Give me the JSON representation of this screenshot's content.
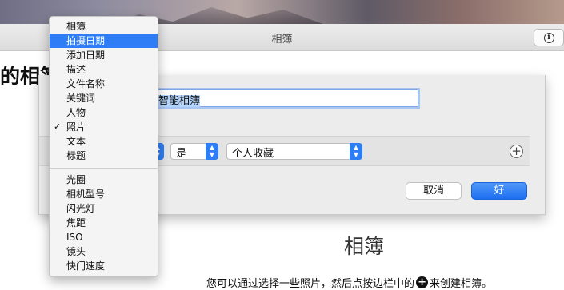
{
  "window": {
    "title": "相簿",
    "heading": "的相簿"
  },
  "empty_state": {
    "title": "相簿",
    "hint_before": "您可以通过选择一些照片，然后点按边栏中的",
    "hint_after": "来创建相簿。",
    "plus_glyph": "+"
  },
  "sheet": {
    "name_field_value": "命名智能相簿",
    "rule": {
      "operator": "是",
      "value": "个人收藏"
    },
    "add_rule_glyph": "+",
    "cancel_label": "取消",
    "ok_label": "好"
  },
  "menu": {
    "group1": [
      {
        "label": "相簿",
        "highlighted": false,
        "checked": false
      },
      {
        "label": "拍摄日期",
        "highlighted": true,
        "checked": false
      },
      {
        "label": "添加日期",
        "highlighted": false,
        "checked": false
      },
      {
        "label": "描述",
        "highlighted": false,
        "checked": false
      },
      {
        "label": "文件名称",
        "highlighted": false,
        "checked": false
      },
      {
        "label": "关键词",
        "highlighted": false,
        "checked": false
      },
      {
        "label": "人物",
        "highlighted": false,
        "checked": false
      },
      {
        "label": "照片",
        "highlighted": false,
        "checked": true
      },
      {
        "label": "文本",
        "highlighted": false,
        "checked": false
      },
      {
        "label": "标题",
        "highlighted": false,
        "checked": false
      }
    ],
    "group2": [
      {
        "label": "光圈"
      },
      {
        "label": "相机型号"
      },
      {
        "label": "闪光灯"
      },
      {
        "label": "焦距"
      },
      {
        "label": "ISO"
      },
      {
        "label": "镜头"
      },
      {
        "label": "快门速度"
      }
    ],
    "check_glyph": "✓"
  },
  "colors": {
    "accent": "#2f7df6",
    "dialog_bg": "#ececec"
  }
}
